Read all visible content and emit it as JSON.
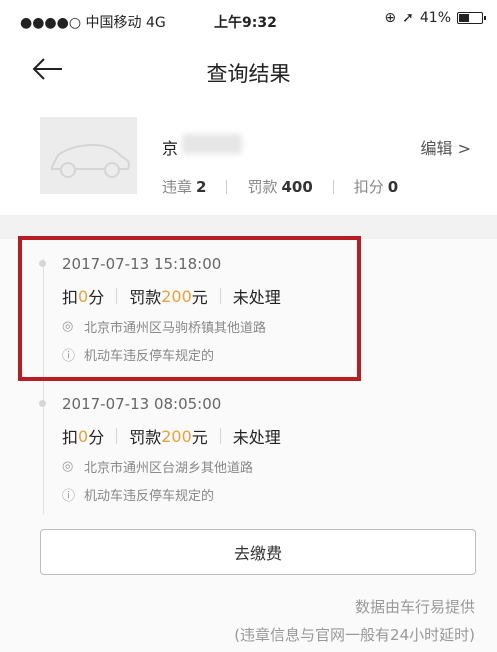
{
  "status_bar": {
    "carrier": "●●●●○ 中国移动  4G",
    "time": "上午9:32",
    "battery": "41%"
  },
  "nav": {
    "title": "查询结果"
  },
  "car": {
    "plate_prefix": "京",
    "edit_label": "编辑 >",
    "violations_label": "违章",
    "violations_count": "2",
    "fine_label": "罚款",
    "fine_amount": "400",
    "points_label": "扣分",
    "points_count": "0"
  },
  "records": [
    {
      "datetime": "2017-07-13 15:18:00",
      "points_prefix": "扣",
      "points_value": "0",
      "points_suffix": "分",
      "fine_prefix": "罚款",
      "fine_value": "200",
      "fine_suffix": "元",
      "status": "未处理",
      "location": "北京市通州区马驹桥镇其他道路",
      "reason": "机动车违反停车规定的"
    },
    {
      "datetime": "2017-07-13 08:05:00",
      "points_prefix": "扣",
      "points_value": "0",
      "points_suffix": "分",
      "fine_prefix": "罚款",
      "fine_value": "200",
      "fine_suffix": "元",
      "status": "未处理",
      "location": "北京市通州区台湖乡其他道路",
      "reason": "机动车违反停车规定的"
    }
  ],
  "pay_button": "去缴费",
  "footer": {
    "source": "数据由车行易提供",
    "delay_note": "(违章信息与官网一般有24小时延时)"
  },
  "colors": {
    "highlight_border": "#b81d22",
    "amount_accent": "#e8a23a"
  }
}
